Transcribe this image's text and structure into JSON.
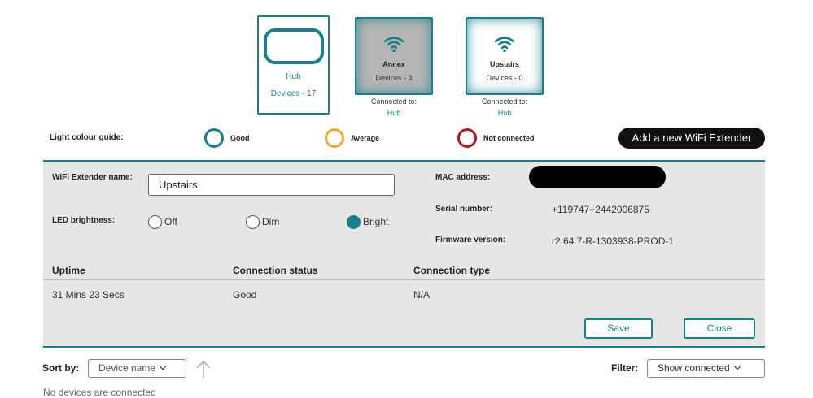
{
  "hub": {
    "name": "Hub",
    "devices": "Devices - 17"
  },
  "extenders": [
    {
      "name": "Annex",
      "devices": "Devices - 3",
      "connected_label": "Connected to:",
      "connected_to": "Hub"
    },
    {
      "name": "Upstairs",
      "devices": "Devices - 0",
      "connected_label": "Connected to:",
      "connected_to": "Hub"
    }
  ],
  "guide": {
    "label": "Light colour guide:",
    "good": "Good",
    "average": "Average",
    "not_connected": "Not connected"
  },
  "add_button": "Add a new WiFi Extender",
  "details": {
    "name_label": "WiFi Extender name:",
    "name_value": "Upstairs",
    "led_label": "LED brightness:",
    "led_options": [
      "Off",
      "Dim",
      "Bright"
    ],
    "led_selected": "Bright",
    "mac_label": "MAC address:",
    "serial_label": "Serial number:",
    "serial_value": "+119747+2442006875",
    "firmware_label": "Firmware version:",
    "firmware_value": "r2.64.7-R-1303938-PROD-1",
    "columns": [
      "Uptime",
      "Connection status",
      "Connection type"
    ],
    "row": [
      "31 Mins 23 Secs",
      "Good",
      "N/A"
    ],
    "save": "Save",
    "close": "Close"
  },
  "sort": {
    "label": "Sort by:",
    "value": "Device name"
  },
  "filter": {
    "label": "Filter:",
    "value": "Show connected"
  },
  "empty_message": "No devices are connected",
  "colors": {
    "accent": "#1a7f8a",
    "average": "#f0a830",
    "not_connected": "#b31b1b"
  },
  "icons": {
    "wifi": "wifi-icon",
    "sort": "arrow-up-icon",
    "dropdown": "chevron-down-icon"
  }
}
